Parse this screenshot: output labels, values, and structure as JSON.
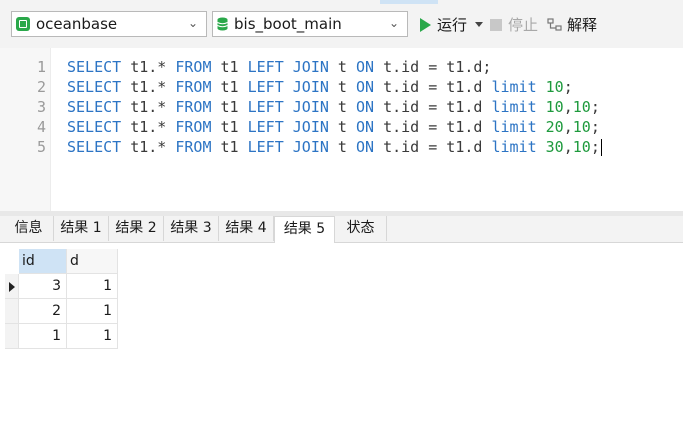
{
  "toolbar": {
    "connection": {
      "label": "oceanbase",
      "icon": "connection-icon"
    },
    "database": {
      "label": "bis_boot_main",
      "icon": "database-icon"
    },
    "run_label": "运行",
    "stop_label": "停止",
    "explain_label": "解释"
  },
  "editor": {
    "lines": [
      {
        "number": "1",
        "parts": [
          [
            "kw",
            "SELECT"
          ],
          [
            "tx",
            " t1.* "
          ],
          [
            "kw",
            "FROM"
          ],
          [
            "tx",
            " t1 "
          ],
          [
            "kw",
            "LEFT JOIN"
          ],
          [
            "tx",
            " t "
          ],
          [
            "kw",
            "ON"
          ],
          [
            "tx",
            " t.id = t1.d;"
          ]
        ]
      },
      {
        "number": "2",
        "parts": [
          [
            "kw",
            "SELECT"
          ],
          [
            "tx",
            " t1.* "
          ],
          [
            "kw",
            "FROM"
          ],
          [
            "tx",
            " t1 "
          ],
          [
            "kw",
            "LEFT JOIN"
          ],
          [
            "tx",
            " t "
          ],
          [
            "kw",
            "ON"
          ],
          [
            "tx",
            " t.id = t1.d "
          ],
          [
            "kw",
            "limit"
          ],
          [
            "tx",
            " "
          ],
          [
            "num",
            "10"
          ],
          [
            "tx",
            ";"
          ]
        ]
      },
      {
        "number": "3",
        "parts": [
          [
            "kw",
            "SELECT"
          ],
          [
            "tx",
            " t1.* "
          ],
          [
            "kw",
            "FROM"
          ],
          [
            "tx",
            " t1 "
          ],
          [
            "kw",
            "LEFT JOIN"
          ],
          [
            "tx",
            " t "
          ],
          [
            "kw",
            "ON"
          ],
          [
            "tx",
            " t.id = t1.d "
          ],
          [
            "kw",
            "limit"
          ],
          [
            "tx",
            " "
          ],
          [
            "num",
            "10"
          ],
          [
            "tx",
            ","
          ],
          [
            "num",
            "10"
          ],
          [
            "tx",
            ";"
          ]
        ]
      },
      {
        "number": "4",
        "parts": [
          [
            "kw",
            "SELECT"
          ],
          [
            "tx",
            " t1.* "
          ],
          [
            "kw",
            "FROM"
          ],
          [
            "tx",
            " t1 "
          ],
          [
            "kw",
            "LEFT JOIN"
          ],
          [
            "tx",
            " t "
          ],
          [
            "kw",
            "ON"
          ],
          [
            "tx",
            " t.id = t1.d "
          ],
          [
            "kw",
            "limit"
          ],
          [
            "tx",
            " "
          ],
          [
            "num",
            "20"
          ],
          [
            "tx",
            ","
          ],
          [
            "num",
            "10"
          ],
          [
            "tx",
            ";"
          ]
        ]
      },
      {
        "number": "5",
        "parts": [
          [
            "kw",
            "SELECT"
          ],
          [
            "tx",
            " t1.* "
          ],
          [
            "kw",
            "FROM"
          ],
          [
            "tx",
            " t1 "
          ],
          [
            "kw",
            "LEFT JOIN"
          ],
          [
            "tx",
            " t "
          ],
          [
            "kw",
            "ON"
          ],
          [
            "tx",
            " t.id = t1.d "
          ],
          [
            "kw",
            "limit"
          ],
          [
            "tx",
            " "
          ],
          [
            "num",
            "30"
          ],
          [
            "tx",
            ","
          ],
          [
            "num",
            "10"
          ],
          [
            "tx",
            ";"
          ]
        ]
      }
    ]
  },
  "tabs": [
    {
      "label": "信息",
      "active": false
    },
    {
      "label": "结果 1",
      "active": false
    },
    {
      "label": "结果 2",
      "active": false
    },
    {
      "label": "结果 3",
      "active": false
    },
    {
      "label": "结果 4",
      "active": false
    },
    {
      "label": "结果 5",
      "active": true
    },
    {
      "label": "状态",
      "active": false
    }
  ],
  "grid": {
    "columns": [
      "id",
      "d"
    ],
    "rows": [
      [
        "3",
        "1"
      ],
      [
        "2",
        "1"
      ],
      [
        "1",
        "1"
      ]
    ],
    "current_row": 0
  },
  "colors": {
    "keyword": "#2c74c4",
    "number": "#1e9a3d",
    "run_icon": "#2aa84a",
    "selected_header": "#cfe3f5"
  }
}
